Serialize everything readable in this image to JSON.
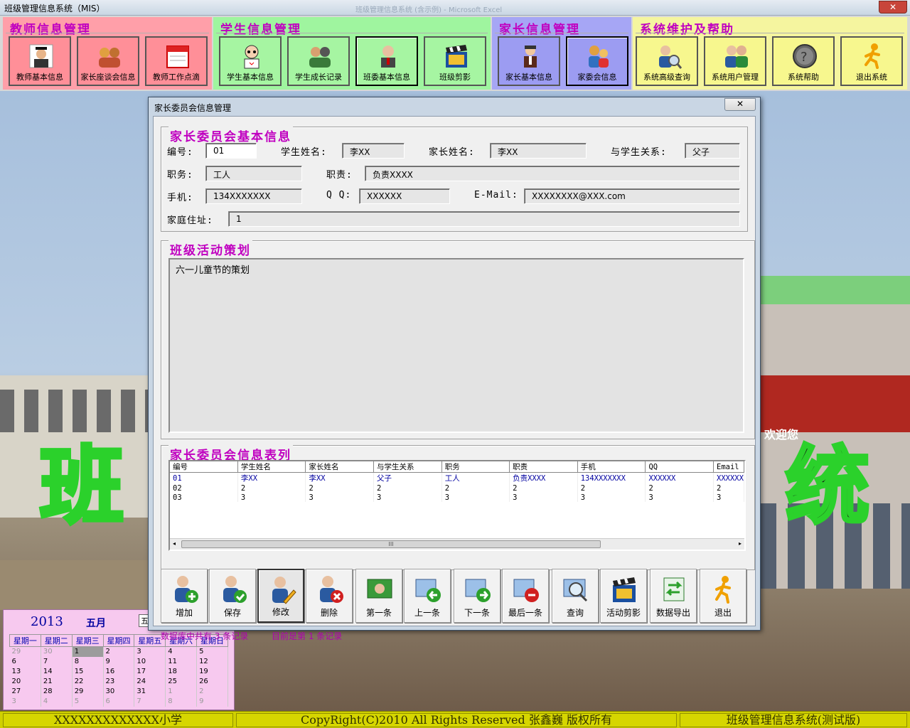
{
  "app": {
    "title": "班级管理信息系统（MIS）",
    "ghost_title": "班级管理信息系统 (含示例) - Microsoft Excel"
  },
  "toolbar": {
    "groups": [
      {
        "title": "教师信息管理",
        "buttons": [
          "教师基本信息",
          "家长座谈会信息",
          "教师工作点滴"
        ]
      },
      {
        "title": "学生信息管理",
        "buttons": [
          "学生基本信息",
          "学生成长记录",
          "班委基本信息",
          "班级剪影"
        ]
      },
      {
        "title": "家长信息管理",
        "buttons": [
          "家长基本信息",
          "家委会信息"
        ]
      },
      {
        "title": "系统维护及帮助",
        "buttons": [
          "系统高级查询",
          "系统用户管理",
          "系统帮助",
          "退出系统"
        ]
      }
    ]
  },
  "background": {
    "char_left": "班",
    "char_right": "统",
    "sign_text": "欢迎您"
  },
  "dialog": {
    "title": "家长委员会信息管理",
    "close": "✕",
    "basic": {
      "title": "家长委员会基本信息",
      "id_label": "编号:",
      "id_value": "01",
      "student_label": "学生姓名:",
      "student_value": "李XX",
      "parent_label": "家长姓名:",
      "parent_value": "李XX",
      "relation_label": "与学生关系:",
      "relation_value": "父子",
      "job_label": "职务:",
      "job_value": "工人",
      "duty_label": "职责:",
      "duty_value": "负责XXXX",
      "phone_label": "手机:",
      "phone_value": "134XXXXXXX",
      "qq_label": "Q Q:",
      "qq_value": "XXXXXX",
      "email_label": "E-Mail:",
      "email_value": "XXXXXXXX@XXX.com",
      "address_label": "家庭住址:",
      "address_value": "1"
    },
    "plan": {
      "title": "班级活动策划",
      "text": "六一儿童节的策划"
    },
    "list": {
      "title": "家长委员会信息表列",
      "columns": [
        "编号",
        "学生姓名",
        "家长姓名",
        "与学生关系",
        "职务",
        "职责",
        "手机",
        "QQ",
        "Email"
      ],
      "rows": [
        [
          "01",
          "李XX",
          "李XX",
          "父子",
          "工人",
          "负责XXXX",
          "134XXXXXXX",
          "XXXXXX",
          "XXXXXX"
        ],
        [
          "02",
          "2",
          "2",
          "2",
          "2",
          "2",
          "2",
          "2",
          "2"
        ],
        [
          "03",
          "3",
          "3",
          "3",
          "3",
          "3",
          "3",
          "3",
          "3"
        ]
      ],
      "scroll_left": "◂",
      "scroll_right": "▸",
      "scroll_grip": "III"
    },
    "actions": [
      "增加",
      "保存",
      "修改",
      "删除",
      "第一条",
      "上一条",
      "下一条",
      "最后一条",
      "查询",
      "活动剪影",
      "数据导出",
      "退出"
    ],
    "record_total": "数据库中共有 3 条记录",
    "record_current": "目前是第 1 条记录"
  },
  "calendar": {
    "year": "2013",
    "month": "五月",
    "select": "五",
    "weekdays": [
      "星期一",
      "星期二",
      "星期三",
      "星期四",
      "星期五",
      "星期六",
      "星期日"
    ],
    "weeks": [
      [
        "29",
        "30",
        "1",
        "2",
        "3",
        "4",
        "5"
      ],
      [
        "6",
        "7",
        "8",
        "9",
        "10",
        "11",
        "12"
      ],
      [
        "13",
        "14",
        "15",
        "16",
        "17",
        "18",
        "19"
      ],
      [
        "20",
        "21",
        "22",
        "23",
        "24",
        "25",
        "26"
      ],
      [
        "27",
        "28",
        "29",
        "30",
        "31",
        "1",
        "2"
      ],
      [
        "3",
        "4",
        "5",
        "6",
        "7",
        "8",
        "9"
      ]
    ]
  },
  "status": {
    "school": "XXXXXXXXXXXXX小学",
    "copyright": "CopyRight(C)2010  All Rights Reserved 张鑫巍  版权所有",
    "system": "班级管理信息系统(测试版)"
  },
  "colors": {
    "teacher": "#ff9fa9",
    "student": "#9ff59f",
    "parent": "#a6a6f5",
    "system": "#f5f59f",
    "title_magenta": "#c000c0",
    "status_bar": "#d0d000"
  }
}
